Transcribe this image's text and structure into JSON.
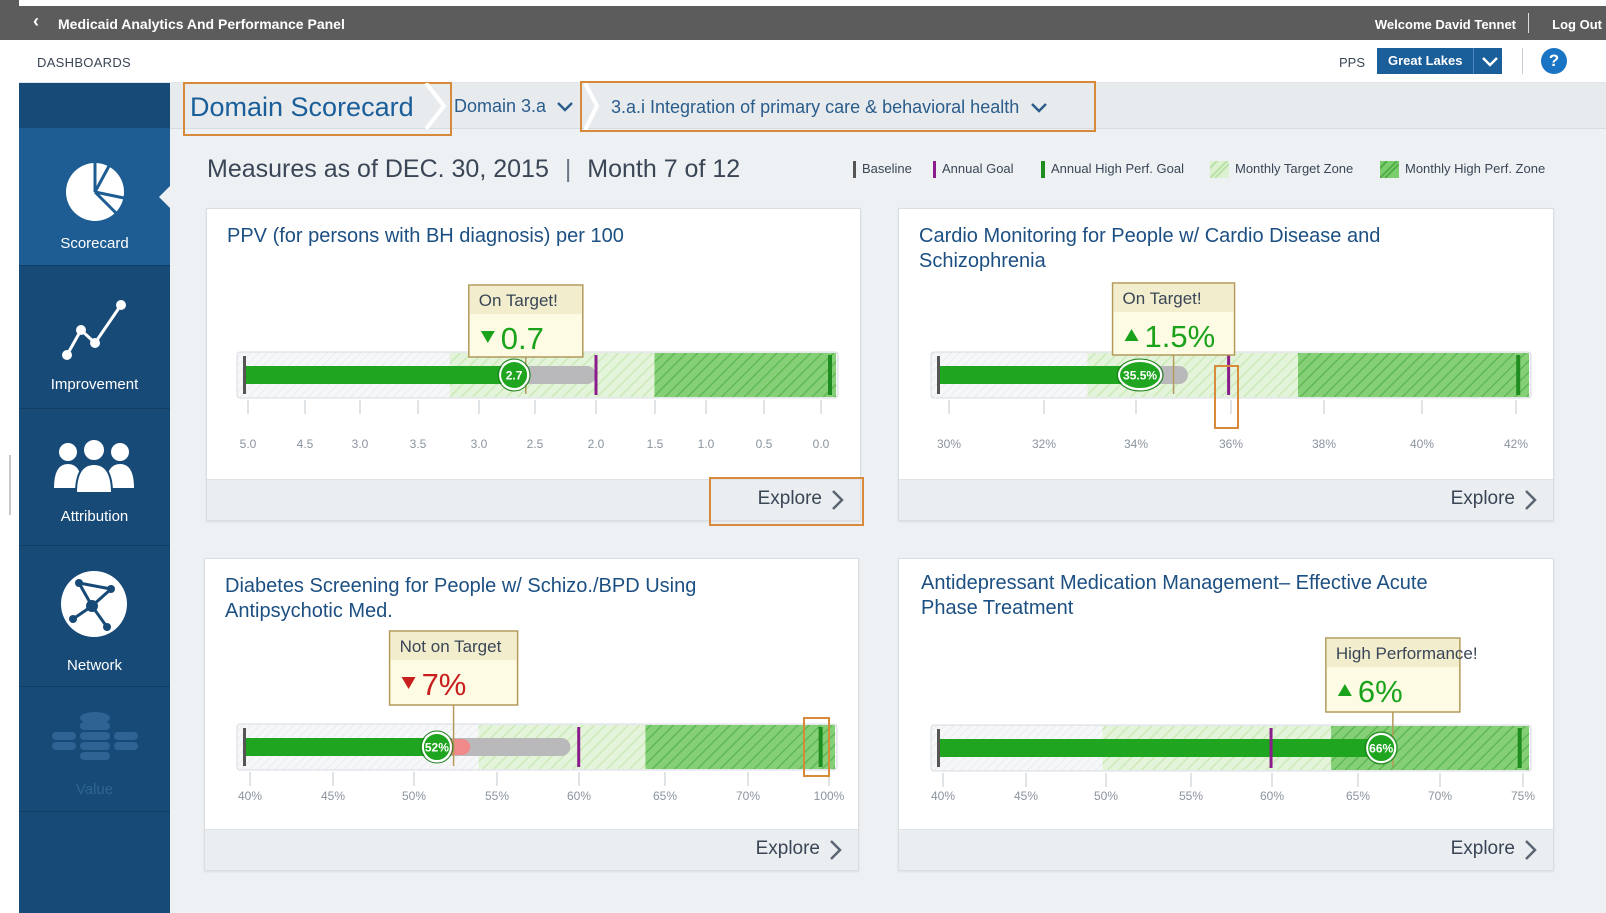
{
  "header": {
    "back_glyph": "‹",
    "app_title": "Medicaid Analytics And Performance Panel",
    "welcome": "Welcome David Tennet",
    "logout": "Log Out"
  },
  "subheader": {
    "section": "DASHBOARDS",
    "pps_label": "PPS",
    "pps_value": "Great Lakes",
    "help": "?"
  },
  "sidebar": {
    "items": [
      {
        "label": "Scorecard",
        "icon": "pie-chart-icon",
        "active": true
      },
      {
        "label": "Improvement",
        "icon": "trend-line-icon"
      },
      {
        "label": "Attribution",
        "icon": "people-group-icon"
      },
      {
        "label": "Network",
        "icon": "network-globe-icon"
      },
      {
        "label": "Value",
        "icon": "coin-stack-icon",
        "disabled": true
      }
    ]
  },
  "breadcrumb": {
    "title": "Domain Scorecard",
    "domain": "Domain 3.a",
    "project": "3.a.i Integration of primary care & behavioral health"
  },
  "measures": {
    "as_of": "Measures as of DEC. 30, 2015",
    "month": "Month 7 of 12"
  },
  "legend": [
    {
      "label": "Baseline",
      "color": "#555555"
    },
    {
      "label": "Annual Goal",
      "color": "#8b1c8b"
    },
    {
      "label": "Annual High Perf. Goal",
      "color": "#1e8c1e"
    },
    {
      "label": "Monthly Target Zone",
      "color": "#d4eec4"
    },
    {
      "label": "Monthly High Perf. Zone",
      "color": "#7ccd6e"
    }
  ],
  "colors": {
    "header_bg": "#5c5c5c",
    "sidebar_bg": "#174a77",
    "sidebar_active": "#1e5d93",
    "title_blue": "#1c4f82",
    "bar_green": "#1fa51f",
    "goal_purple": "#8b1c8b",
    "status_green": "#1aa31a",
    "status_red": "#c81e1e",
    "highlight_orange": "#d68a3a"
  },
  "cards": [
    {
      "title_lines": [
        "PPV (for persons with BH diagnosis) per 100"
      ],
      "status": "On Target!",
      "change": "0.7",
      "change_dir": "down",
      "change_color": "green",
      "current_label": "2.7",
      "explore": "Explore",
      "ticks": [
        "5.0",
        "4.5",
        "3.0",
        "3.5",
        "3.0",
        "2.5",
        "2.0",
        "1.5",
        "1.0",
        "0.5",
        "0.0"
      ],
      "reversed": true,
      "scale": [
        5.0,
        0.0
      ],
      "values": {
        "baseline": 5.0,
        "current": 2.7,
        "prior": 2.0,
        "target_zone": [
          3.25,
          1.5
        ],
        "high_perf_zone": [
          1.5,
          0.0
        ],
        "annual_goal": 2.0,
        "high_perf_goal": 0.0,
        "callout": 2.6
      }
    },
    {
      "title_lines": [
        "Cardio Monitoring for People w/ Cardio Disease and",
        "Schizophrenia"
      ],
      "status": "On Target!",
      "change": "1.5%",
      "change_dir": "up",
      "change_color": "green",
      "current_label": "35.5%",
      "explore": "Explore",
      "ticks": [
        "30%",
        "32%",
        "34%",
        "36%",
        "38%",
        "40%",
        "42%"
      ],
      "scale": [
        29.8,
        42.0
      ],
      "values": {
        "baseline": 29.8,
        "current": 34.0,
        "prior": 35.0,
        "target_zone": [
          32.9,
          37.3
        ],
        "high_perf_zone": [
          37.3,
          42.0
        ],
        "annual_goal": 35.85,
        "high_perf_goal": 41.9,
        "callout": 34.7
      }
    },
    {
      "title_lines": [
        "Diabetes Screening for People w/ Schizo./BPD Using",
        "Antipsychotic Med."
      ],
      "status": "Not on Target",
      "change": "7%",
      "change_dir": "down",
      "change_color": "red",
      "current_label": "52%",
      "explore": "Explore",
      "ticks": [
        "40%",
        "45%",
        "50%",
        "55%",
        "60%",
        "65%",
        "70%",
        "100%"
      ],
      "scale": [
        40,
        75
      ],
      "values": {
        "baseline": 40,
        "current": 51.5,
        "drop": 53.5,
        "prior": 59.5,
        "target_zone": [
          54,
          64
        ],
        "high_perf_zone": [
          64,
          75
        ],
        "annual_goal": 60,
        "high_perf_goal": 74.5,
        "callout": 52.5
      }
    },
    {
      "title_lines": [
        "Antidepressant Medication Management– Effective Acute",
        "Phase Treatment"
      ],
      "status": "High Performance!",
      "change": "6%",
      "change_dir": "up",
      "change_color": "green",
      "current_label": "66%",
      "explore": "Explore",
      "ticks": [
        "40%",
        "45%",
        "50%",
        "55%",
        "60%",
        "65%",
        "70%",
        "75%"
      ],
      "scale": [
        40,
        75
      ],
      "values": {
        "baseline": 40,
        "current": 66.5,
        "target_zone": [
          49.8,
          63.5
        ],
        "high_perf_zone": [
          63.5,
          75
        ],
        "annual_goal": 59.9,
        "high_perf_goal": 74.8,
        "callout": 67.2
      }
    }
  ]
}
